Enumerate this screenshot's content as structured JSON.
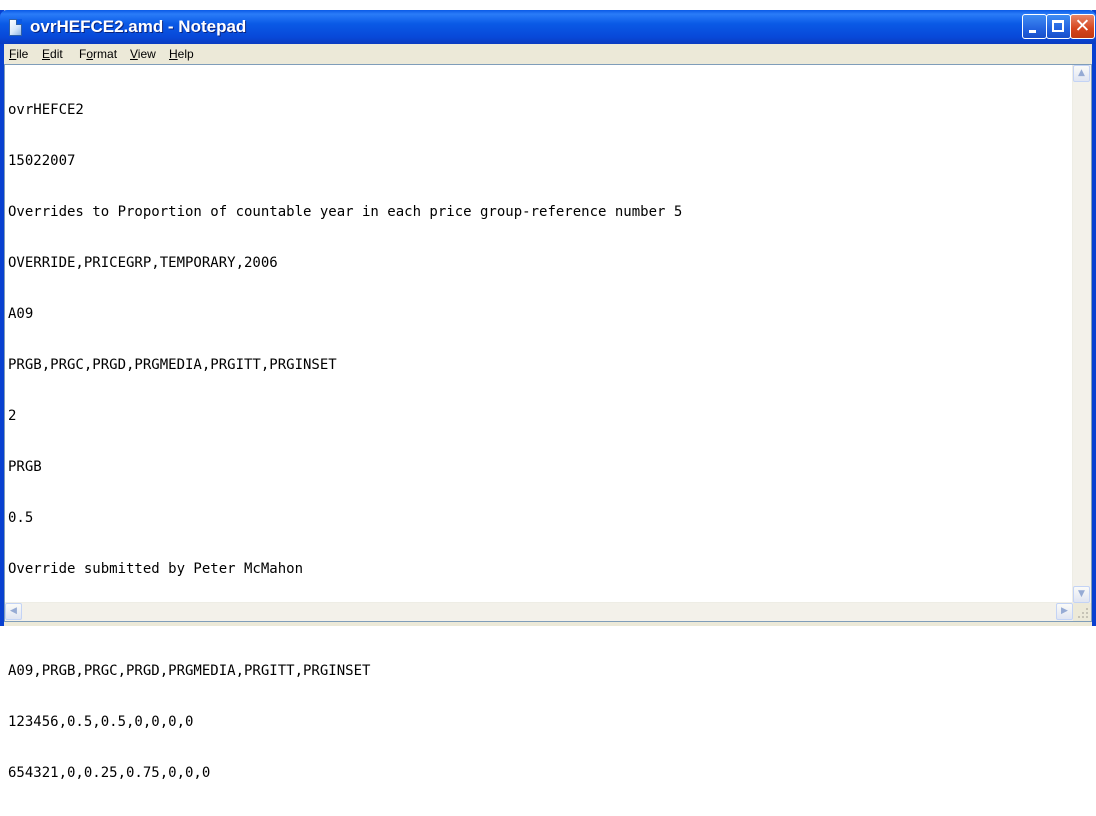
{
  "window": {
    "title": "ovrHEFCE2.amd - Notepad",
    "icon": "notepad-document-icon",
    "controls": [
      "minimize-icon",
      "maximize-icon",
      "close-icon"
    ],
    "close_glyph": "✕"
  },
  "menu": [
    {
      "underline": "F",
      "rest": "ile"
    },
    {
      "underline": "E",
      "rest": "dit"
    },
    {
      "pre": "F",
      "underline": "o",
      "rest": "rmat"
    },
    {
      "underline": "V",
      "rest": "iew"
    },
    {
      "underline": "H",
      "rest": "elp"
    }
  ],
  "document": {
    "lines": [
      "ovrHEFCE2",
      "15022007",
      "Overrides to Proportion of countable year in each price group-reference number 5",
      "OVERRIDE,PRICEGRP,TEMPORARY,2006",
      "A09",
      "PRGB,PRGC,PRGD,PRGMEDIA,PRGITT,PRGINSET",
      "2",
      "PRGB",
      "0.5",
      "Override submitted by Peter McMahon",
      "",
      "A09,PRGB,PRGC,PRGD,PRGMEDIA,PRGITT,PRGINSET",
      "123456,0.5,0.5,0,0,0,0",
      "654321,0,0.25,0.75,0,0,0"
    ]
  },
  "scrollbars": {
    "up_glyph": "▲",
    "down_glyph": "▼",
    "left_glyph": "◀",
    "right_glyph": "▶"
  }
}
